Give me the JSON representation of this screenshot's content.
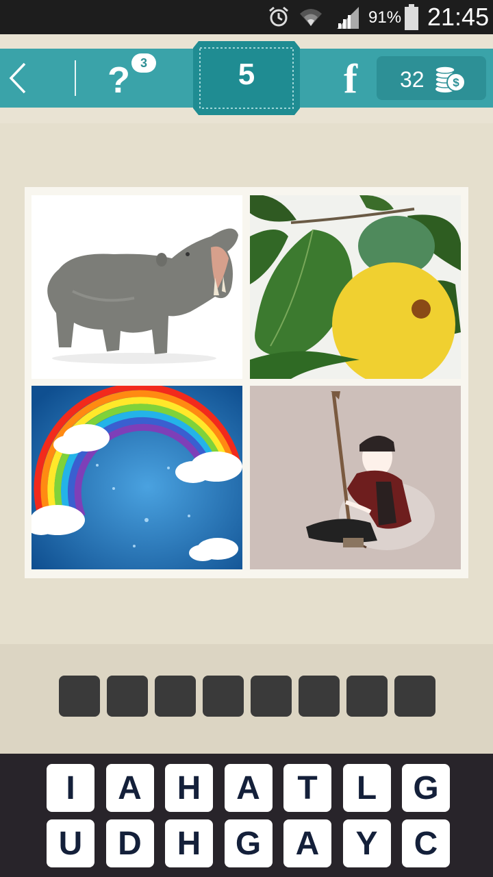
{
  "status_bar": {
    "battery": "91%",
    "time": "21:45",
    "icons": [
      "alarm-icon",
      "wifi-icon",
      "signal-icon",
      "battery-icon"
    ]
  },
  "toolbar": {
    "back_icon": "chevron-left-icon",
    "hint_label": "?",
    "hint_count": "3",
    "level": "5",
    "facebook_label": "f",
    "coins": "32",
    "coins_icon": "coin-stack-icon",
    "colors": {
      "bar": "#3aa3a9",
      "level": "#1f8c92",
      "coins": "#2d9096"
    }
  },
  "pictures": [
    {
      "name": "hippo-picture"
    },
    {
      "name": "fruit-picture"
    },
    {
      "name": "rainbow-picture"
    },
    {
      "name": "musician-picture"
    }
  ],
  "answer_slot_count": 8,
  "keyboard": {
    "row1": [
      "I",
      "A",
      "H",
      "A",
      "T",
      "L",
      "G"
    ],
    "row2": [
      "U",
      "D",
      "H",
      "G",
      "A",
      "Y",
      "C"
    ]
  }
}
